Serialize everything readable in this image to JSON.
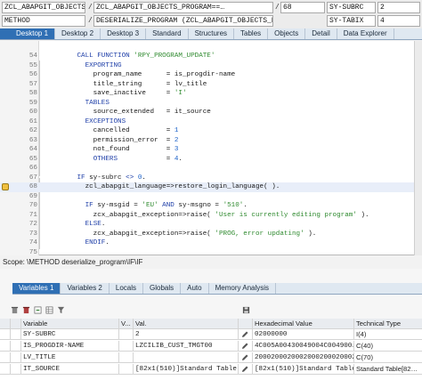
{
  "top_fields": {
    "row1": {
      "program": "ZCL_ABAPGIT_OBJECTS_PROGRAM==…",
      "include": "ZCL_ABAPGIT_OBJECTS_PROGRAM==…",
      "line": "68",
      "sysvar": "SY-SUBRC",
      "sysval": "2"
    },
    "row2": {
      "type": "METHOD",
      "name": "DESERIALIZE_PROGRAM (ZCL_ABAPGIT_OBJECTS_PRO…",
      "sysvar": "SY-TABIX",
      "sysval": "4"
    },
    "separator": "/"
  },
  "tabs": [
    "Desktop 1",
    "Desktop 2",
    "Desktop 3",
    "Standard",
    "Structures",
    "Tables",
    "Objects",
    "Detail",
    "Data Explorer"
  ],
  "active_tab": "Desktop 1",
  "code_lines": [
    {
      "num": "54",
      "parts": [
        [
          "",
          "        "
        ],
        [
          "kw",
          "CALL FUNCTION "
        ],
        [
          "str",
          "'RPY_PROGRAM_UPDATE'"
        ]
      ]
    },
    {
      "num": "55",
      "parts": [
        [
          "",
          "          "
        ],
        [
          "kw",
          "EXPORTING"
        ]
      ]
    },
    {
      "num": "56",
      "parts": [
        [
          "",
          "            program_name      = is_progdir-name"
        ]
      ]
    },
    {
      "num": "57",
      "parts": [
        [
          "",
          "            title_string      = lv_title"
        ]
      ]
    },
    {
      "num": "58",
      "parts": [
        [
          "",
          "            save_inactive     = "
        ],
        [
          "str",
          "'I'"
        ]
      ]
    },
    {
      "num": "59",
      "parts": [
        [
          "",
          "          "
        ],
        [
          "kw",
          "TABLES"
        ]
      ]
    },
    {
      "num": "60",
      "parts": [
        [
          "",
          "            source_extended   = it_source"
        ]
      ]
    },
    {
      "num": "61",
      "parts": [
        [
          "",
          "          "
        ],
        [
          "kw",
          "EXCEPTIONS"
        ]
      ]
    },
    {
      "num": "62",
      "parts": [
        [
          "",
          "            cancelled         = "
        ],
        [
          "num",
          "1"
        ]
      ]
    },
    {
      "num": "63",
      "parts": [
        [
          "",
          "            permission_error  = "
        ],
        [
          "num",
          "2"
        ]
      ]
    },
    {
      "num": "64",
      "parts": [
        [
          "",
          "            not_found         = "
        ],
        [
          "num",
          "3"
        ]
      ]
    },
    {
      "num": "65",
      "parts": [
        [
          "",
          "            "
        ],
        [
          "kw",
          "OTHERS"
        ],
        [
          "",
          "            = "
        ],
        [
          "num",
          "4"
        ],
        [
          "",
          "."
        ]
      ]
    },
    {
      "num": "66",
      "parts": [
        [
          "",
          ""
        ]
      ]
    },
    {
      "num": "67",
      "parts": [
        [
          "",
          "        "
        ],
        [
          "kw",
          "IF "
        ],
        [
          "",
          "sy-subrc "
        ],
        [
          "kw",
          "<> "
        ],
        [
          "num",
          "0"
        ],
        [
          "",
          "."
        ]
      ]
    },
    {
      "num": "68",
      "current": true,
      "parts": [
        [
          "",
          "          zcl_abapgit_language=>restore_login_language( )."
        ]
      ]
    },
    {
      "num": "69",
      "parts": [
        [
          "",
          ""
        ]
      ]
    },
    {
      "num": "70",
      "parts": [
        [
          "",
          "          "
        ],
        [
          "kw",
          "IF "
        ],
        [
          "",
          "sy-msgid = "
        ],
        [
          "str",
          "'EU'"
        ],
        [
          "kw",
          " AND "
        ],
        [
          "",
          "sy-msgno = "
        ],
        [
          "str",
          "'510'"
        ],
        [
          "",
          "."
        ]
      ]
    },
    {
      "num": "71",
      "parts": [
        [
          "",
          "            zcx_abapgit_exception=>raise( "
        ],
        [
          "str",
          "'User is currently editing program'"
        ],
        [
          "",
          " )."
        ]
      ]
    },
    {
      "num": "72",
      "parts": [
        [
          "",
          "          "
        ],
        [
          "kw",
          "ELSE"
        ],
        [
          "",
          "."
        ]
      ]
    },
    {
      "num": "73",
      "parts": [
        [
          "",
          "            zcx_abapgit_exception=>raise( "
        ],
        [
          "str",
          "'PROG, error updating'"
        ],
        [
          "",
          " )."
        ]
      ]
    },
    {
      "num": "74",
      "parts": [
        [
          "",
          "          "
        ],
        [
          "kw",
          "ENDIF"
        ],
        [
          "",
          "."
        ]
      ]
    },
    {
      "num": "75",
      "parts": [
        [
          "",
          ""
        ]
      ]
    }
  ],
  "scope_text": "Scope: \\METHOD deserialize_program\\IF\\IF",
  "lower_tabs": [
    "Variables 1",
    "Variables 2",
    "Locals",
    "Globals",
    "Auto",
    "Memory Analysis"
  ],
  "active_lower_tab": "Variables 1",
  "var_headers": {
    "variable": "Variable",
    "v": "V...",
    "val": "Val.",
    "hex": "Hexadecimal Value",
    "type": "Technical Type"
  },
  "variables": [
    {
      "name": "SY-SUBRC",
      "val": "2",
      "hex": "02000000",
      "type": "I(4)"
    },
    {
      "name": "IS_PROGDIR-NAME",
      "val": "LZCILIB_CUST_TMGT00",
      "hex": "4C005A00430049004C004900…",
      "type": "C(40)"
    },
    {
      "name": "LV_TITLE",
      "val": "",
      "hex": "2000200020002000200020002…",
      "type": "C(70)"
    },
    {
      "name": "IT_SOURCE",
      "val": "[82x1(510)]Standard Table",
      "hex": "[82x1(510)]Standard Table",
      "type": "Standard Table[82…"
    }
  ],
  "colors": {
    "accent": "#2f6fb4",
    "keyword": "#1f3fa8",
    "string": "#2f8a2f",
    "number": "#1a60c8"
  }
}
